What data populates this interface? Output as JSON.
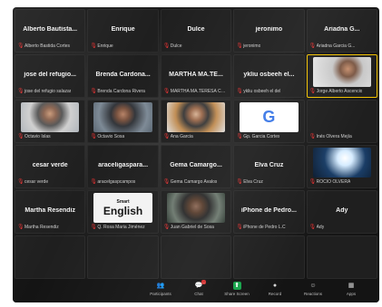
{
  "tiles": [
    {
      "center_name": "Alberto Bautista...",
      "footer_name": "Alberto Bastida Cortes",
      "type": "name"
    },
    {
      "center_name": "Enrique",
      "footer_name": "Enrique",
      "type": "name"
    },
    {
      "center_name": "Dulce",
      "footer_name": "Dulce",
      "type": "name"
    },
    {
      "center_name": "jeronimo",
      "footer_name": "jeronimo",
      "type": "name"
    },
    {
      "center_name": "Ariadna G...",
      "footer_name": "Ariadna Garcia G...",
      "type": "name"
    },
    {
      "center_name": "jose del refugio...",
      "footer_name": "jose del refugio salazar",
      "type": "name"
    },
    {
      "center_name": "Brenda Cardona...",
      "footer_name": "Brenda Cardona Rivera",
      "type": "name"
    },
    {
      "center_name": "MARTHA MA.TE...",
      "footer_name": "MARTHA MA.TERESA COR...",
      "type": "name"
    },
    {
      "center_name": "ykliu osbeeh el...",
      "footer_name": "ykliu osbeeh el del",
      "type": "name"
    },
    {
      "center_name": "",
      "footer_name": "Jorge Alberto Ascencio",
      "type": "video",
      "video": "face5",
      "active": true
    },
    {
      "center_name": "",
      "footer_name": "Octavio Islas",
      "type": "video",
      "video": "face"
    },
    {
      "center_name": "",
      "footer_name": "Octavio Sosa",
      "type": "video",
      "video": "face2"
    },
    {
      "center_name": "",
      "footer_name": "Ana Garcia",
      "type": "video",
      "video": "face3"
    },
    {
      "center_name": "",
      "footer_name": "Gp. Garcia Cortes",
      "type": "video",
      "video": "google"
    },
    {
      "center_name": "",
      "footer_name": "Inés Olvera Mejía",
      "type": "name"
    },
    {
      "center_name": "cesar verde",
      "footer_name": "cesar verde",
      "type": "name"
    },
    {
      "center_name": "araceligaspara...",
      "footer_name": "aracelgaspcampos",
      "type": "name"
    },
    {
      "center_name": "Gema Camargo...",
      "footer_name": "Gema Camargo Avalos",
      "type": "name"
    },
    {
      "center_name": "Elva Cruz",
      "footer_name": "Elva Cruz",
      "type": "name"
    },
    {
      "center_name": "",
      "footer_name": "ROCIO OLVERA",
      "type": "video",
      "video": "water"
    },
    {
      "center_name": "Martha Resendiz",
      "footer_name": "Martha Resendiz",
      "type": "name"
    },
    {
      "center_name": "",
      "footer_name": "Q. Rosa Maria Jiménez",
      "type": "video",
      "video": "english",
      "english_top": "Smart",
      "english_main": "English"
    },
    {
      "center_name": "",
      "footer_name": "Juan Gabriel de Sosa",
      "type": "video",
      "video": "face4"
    },
    {
      "center_name": "iPhone de Pedro...",
      "footer_name": "iPhone de Pedro L.C",
      "type": "name"
    },
    {
      "center_name": "Ady",
      "footer_name": "Ady",
      "type": "name"
    },
    {
      "center_name": "",
      "footer_name": "",
      "type": "empty"
    },
    {
      "center_name": "",
      "footer_name": "",
      "type": "empty"
    },
    {
      "center_name": "",
      "footer_name": "",
      "type": "empty"
    },
    {
      "center_name": "",
      "footer_name": "",
      "type": "empty"
    },
    {
      "center_name": "",
      "footer_name": "",
      "type": "empty"
    }
  ],
  "toolbar": {
    "items": [
      {
        "label": "Participants",
        "icon": "participants-icon",
        "glyph": "👥",
        "badge": ""
      },
      {
        "label": "Chat",
        "icon": "chat-icon",
        "glyph": "💬",
        "badge": "..."
      },
      {
        "label": "Share Screen",
        "icon": "share-screen-icon",
        "glyph": "⬆",
        "badge": ""
      },
      {
        "label": "Record",
        "icon": "record-icon",
        "glyph": "●",
        "badge": ""
      },
      {
        "label": "Reactions",
        "icon": "reactions-icon",
        "glyph": "☺",
        "badge": ""
      },
      {
        "label": "Apps",
        "icon": "apps-icon",
        "glyph": "▦",
        "badge": ""
      }
    ]
  },
  "colors": {
    "active_border": "#f2c200",
    "mic_muted": "#e03030",
    "share_green": "#16a34a"
  }
}
